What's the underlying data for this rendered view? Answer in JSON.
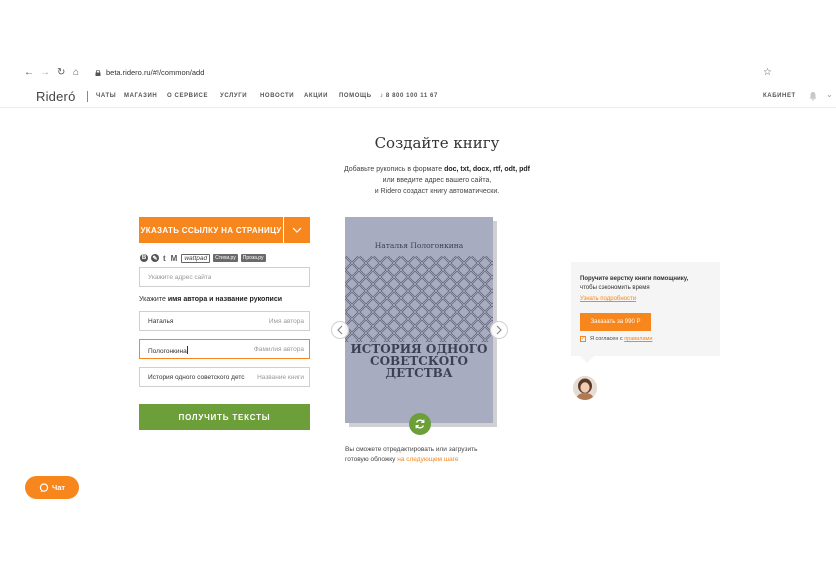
{
  "browser": {
    "url": "beta.ridero.ru/#!/common/add",
    "back_icon": "arrow-left-icon",
    "forward_icon": "arrow-right-icon",
    "reload_icon": "reload-icon",
    "home_icon": "home-icon"
  },
  "header": {
    "logo": "Rideró",
    "nav": [
      "ЧАТЫ",
      "МАГАЗИН",
      "О СЕРВИСЕ",
      "УСЛУГИ",
      "НОВОСТИ",
      "АКЦИИ",
      "ПОМОЩЬ"
    ],
    "phone": "8 800 100 11 67",
    "cabinet": "КАБИНЕТ"
  },
  "main": {
    "title": "Создайте книгу",
    "intro_line1_prefix": "Добавьте рукопись в формате ",
    "intro_formats": "doc, txt, docx, rtf, odt, pdf",
    "intro_line2": "или введите адрес вашего сайта,",
    "intro_line3": "и Ridero создаст книгу автоматически."
  },
  "form": {
    "link_button": "УКАЗАТЬ ССЫЛКУ НА СТРАНИЦУ",
    "socials": [
      "blogger",
      "livejournal",
      "tumblr",
      "medium",
      "wattpad",
      "Стихи.ру",
      "Проза.ру"
    ],
    "social_labels": {
      "tumblr": "t",
      "medium": "M",
      "wattpad": "wattpad",
      "stihi": "Стихи.ру",
      "proza": "Проза.ру"
    },
    "site_placeholder": "Укажите адрес сайта",
    "author_label_prefix": "Укажите ",
    "author_label_bold": "имя автора и название рукописи",
    "first_name_value": "Наталья",
    "first_name_placeholder": "Имя автора",
    "last_name_value": "Пологонкина",
    "last_name_placeholder": "Фамилия автора",
    "book_title_value": "История одного советского детс",
    "book_title_placeholder": "Название книги",
    "get_texts_button": "ПОЛУЧИТЬ ТЕКСТЫ"
  },
  "cover": {
    "author": "Наталья Пологонкина",
    "title_line1": "ИСТОРИЯ ОДНОГО",
    "title_line2": "СОВЕТСКОГО",
    "title_line3": "ДЕТСТВА",
    "note_line1": "Вы сможете отредактировать или загрузить",
    "note_line2_prefix": "готовую обложку ",
    "note_link": "на следующем шаге"
  },
  "helper": {
    "line1": "Поручите верстку книги помощнику,",
    "line2": "чтобы сэкономить время",
    "details_link": "Узнать подробности",
    "order_button": "Заказать за 990 Р",
    "agree_prefix": "Я согласен с ",
    "agree_link": "правилами"
  },
  "chat": {
    "label": "Чат"
  },
  "colors": {
    "accent": "#f7861c",
    "green": "#6c9f3a",
    "cover": "#a8acc0"
  }
}
